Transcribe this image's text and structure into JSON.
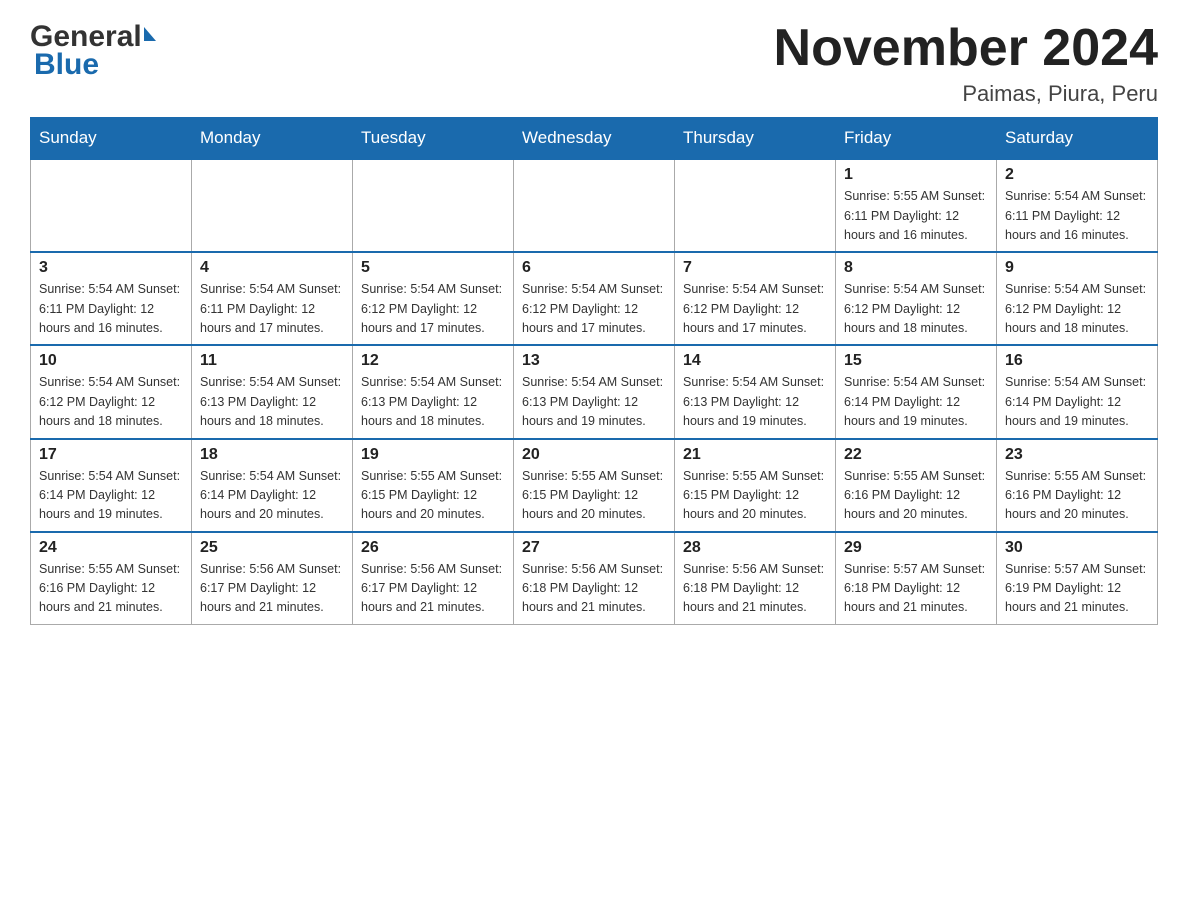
{
  "header": {
    "logo_general": "General",
    "logo_blue": "Blue",
    "month_title": "November 2024",
    "location": "Paimas, Piura, Peru"
  },
  "days_of_week": [
    "Sunday",
    "Monday",
    "Tuesday",
    "Wednesday",
    "Thursday",
    "Friday",
    "Saturday"
  ],
  "weeks": [
    {
      "days": [
        {
          "num": "",
          "info": ""
        },
        {
          "num": "",
          "info": ""
        },
        {
          "num": "",
          "info": ""
        },
        {
          "num": "",
          "info": ""
        },
        {
          "num": "",
          "info": ""
        },
        {
          "num": "1",
          "info": "Sunrise: 5:55 AM\nSunset: 6:11 PM\nDaylight: 12 hours\nand 16 minutes."
        },
        {
          "num": "2",
          "info": "Sunrise: 5:54 AM\nSunset: 6:11 PM\nDaylight: 12 hours\nand 16 minutes."
        }
      ]
    },
    {
      "days": [
        {
          "num": "3",
          "info": "Sunrise: 5:54 AM\nSunset: 6:11 PM\nDaylight: 12 hours\nand 16 minutes."
        },
        {
          "num": "4",
          "info": "Sunrise: 5:54 AM\nSunset: 6:11 PM\nDaylight: 12 hours\nand 17 minutes."
        },
        {
          "num": "5",
          "info": "Sunrise: 5:54 AM\nSunset: 6:12 PM\nDaylight: 12 hours\nand 17 minutes."
        },
        {
          "num": "6",
          "info": "Sunrise: 5:54 AM\nSunset: 6:12 PM\nDaylight: 12 hours\nand 17 minutes."
        },
        {
          "num": "7",
          "info": "Sunrise: 5:54 AM\nSunset: 6:12 PM\nDaylight: 12 hours\nand 17 minutes."
        },
        {
          "num": "8",
          "info": "Sunrise: 5:54 AM\nSunset: 6:12 PM\nDaylight: 12 hours\nand 18 minutes."
        },
        {
          "num": "9",
          "info": "Sunrise: 5:54 AM\nSunset: 6:12 PM\nDaylight: 12 hours\nand 18 minutes."
        }
      ]
    },
    {
      "days": [
        {
          "num": "10",
          "info": "Sunrise: 5:54 AM\nSunset: 6:12 PM\nDaylight: 12 hours\nand 18 minutes."
        },
        {
          "num": "11",
          "info": "Sunrise: 5:54 AM\nSunset: 6:13 PM\nDaylight: 12 hours\nand 18 minutes."
        },
        {
          "num": "12",
          "info": "Sunrise: 5:54 AM\nSunset: 6:13 PM\nDaylight: 12 hours\nand 18 minutes."
        },
        {
          "num": "13",
          "info": "Sunrise: 5:54 AM\nSunset: 6:13 PM\nDaylight: 12 hours\nand 19 minutes."
        },
        {
          "num": "14",
          "info": "Sunrise: 5:54 AM\nSunset: 6:13 PM\nDaylight: 12 hours\nand 19 minutes."
        },
        {
          "num": "15",
          "info": "Sunrise: 5:54 AM\nSunset: 6:14 PM\nDaylight: 12 hours\nand 19 minutes."
        },
        {
          "num": "16",
          "info": "Sunrise: 5:54 AM\nSunset: 6:14 PM\nDaylight: 12 hours\nand 19 minutes."
        }
      ]
    },
    {
      "days": [
        {
          "num": "17",
          "info": "Sunrise: 5:54 AM\nSunset: 6:14 PM\nDaylight: 12 hours\nand 19 minutes."
        },
        {
          "num": "18",
          "info": "Sunrise: 5:54 AM\nSunset: 6:14 PM\nDaylight: 12 hours\nand 20 minutes."
        },
        {
          "num": "19",
          "info": "Sunrise: 5:55 AM\nSunset: 6:15 PM\nDaylight: 12 hours\nand 20 minutes."
        },
        {
          "num": "20",
          "info": "Sunrise: 5:55 AM\nSunset: 6:15 PM\nDaylight: 12 hours\nand 20 minutes."
        },
        {
          "num": "21",
          "info": "Sunrise: 5:55 AM\nSunset: 6:15 PM\nDaylight: 12 hours\nand 20 minutes."
        },
        {
          "num": "22",
          "info": "Sunrise: 5:55 AM\nSunset: 6:16 PM\nDaylight: 12 hours\nand 20 minutes."
        },
        {
          "num": "23",
          "info": "Sunrise: 5:55 AM\nSunset: 6:16 PM\nDaylight: 12 hours\nand 20 minutes."
        }
      ]
    },
    {
      "days": [
        {
          "num": "24",
          "info": "Sunrise: 5:55 AM\nSunset: 6:16 PM\nDaylight: 12 hours\nand 21 minutes."
        },
        {
          "num": "25",
          "info": "Sunrise: 5:56 AM\nSunset: 6:17 PM\nDaylight: 12 hours\nand 21 minutes."
        },
        {
          "num": "26",
          "info": "Sunrise: 5:56 AM\nSunset: 6:17 PM\nDaylight: 12 hours\nand 21 minutes."
        },
        {
          "num": "27",
          "info": "Sunrise: 5:56 AM\nSunset: 6:18 PM\nDaylight: 12 hours\nand 21 minutes."
        },
        {
          "num": "28",
          "info": "Sunrise: 5:56 AM\nSunset: 6:18 PM\nDaylight: 12 hours\nand 21 minutes."
        },
        {
          "num": "29",
          "info": "Sunrise: 5:57 AM\nSunset: 6:18 PM\nDaylight: 12 hours\nand 21 minutes."
        },
        {
          "num": "30",
          "info": "Sunrise: 5:57 AM\nSunset: 6:19 PM\nDaylight: 12 hours\nand 21 minutes."
        }
      ]
    }
  ]
}
